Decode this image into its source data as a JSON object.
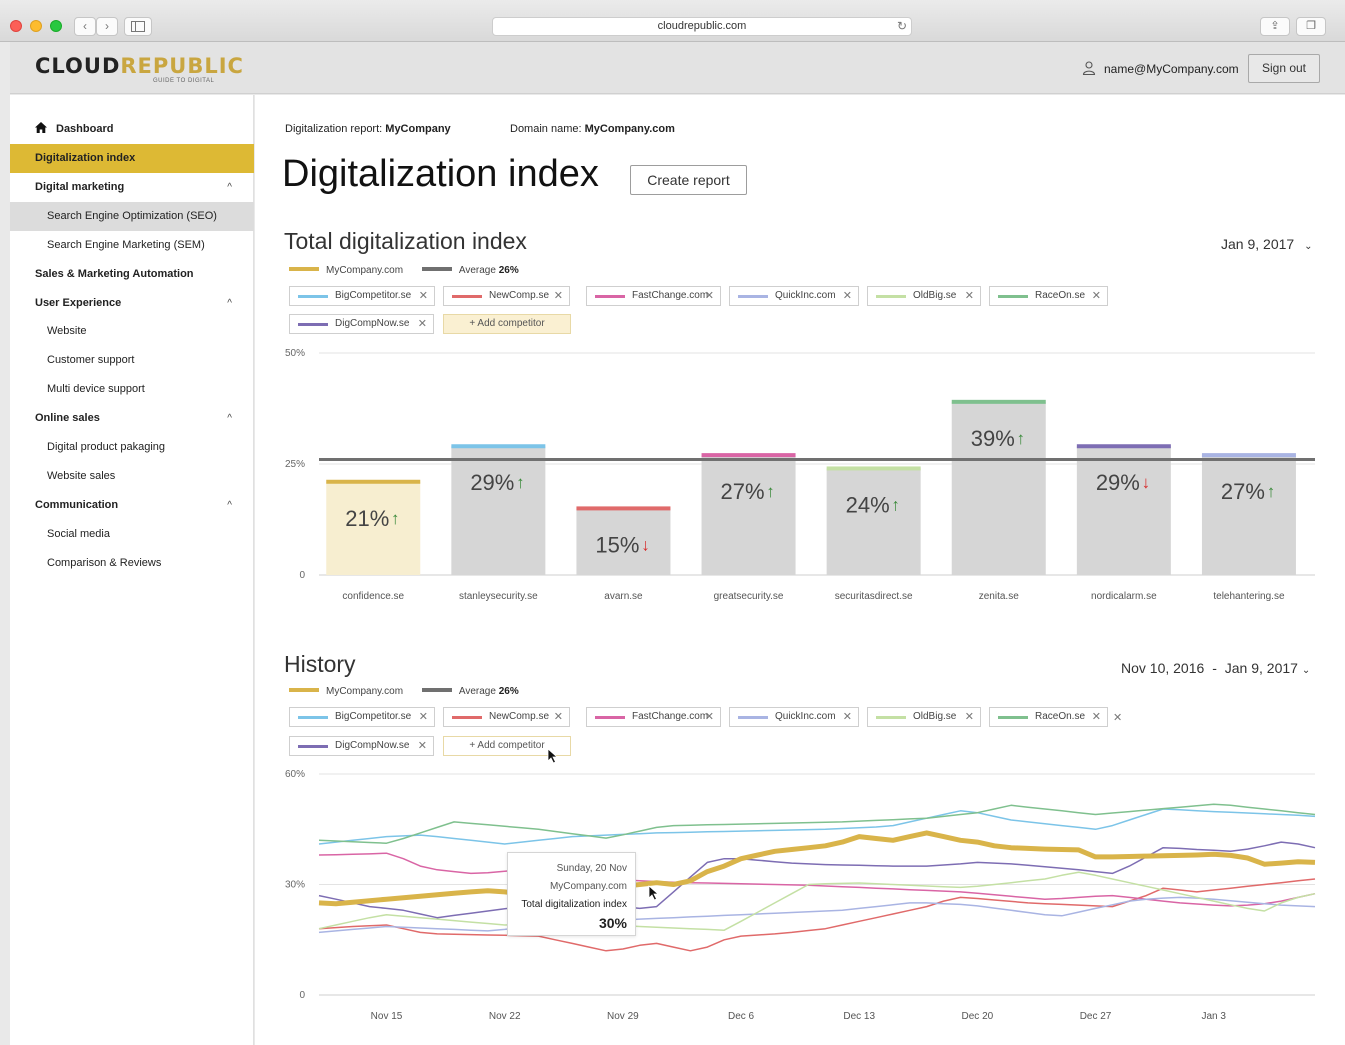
{
  "browser": {
    "url": "cloudrepublic.com"
  },
  "header": {
    "logo_primary": "CLOUD",
    "logo_accent": "REPUBLIC",
    "logo_tagline": "GUIDE TO DIGITAL",
    "user_email": "name@MyCompany.com",
    "signout_label": "Sign out"
  },
  "sidebar": {
    "dashboard": "Dashboard",
    "items": [
      {
        "label": "Digitalization index",
        "level": 1,
        "state": "active"
      },
      {
        "label": "Digital marketing",
        "level": 1,
        "chevron": "^"
      },
      {
        "label": "Search Engine Optimization (SEO)",
        "level": 2,
        "state": "selected"
      },
      {
        "label": "Search Engine Marketing (SEM)",
        "level": 2
      },
      {
        "label": "Sales & Marketing Automation",
        "level": 1
      },
      {
        "label": "User Experience",
        "level": 1,
        "chevron": "^"
      },
      {
        "label": "Website",
        "level": 2
      },
      {
        "label": "Customer support",
        "level": 2
      },
      {
        "label": "Multi device support",
        "level": 2
      },
      {
        "label": "Online sales",
        "level": 1,
        "chevron": "^"
      },
      {
        "label": "Digital product pakaging",
        "level": 2
      },
      {
        "label": "Website sales",
        "level": 2
      },
      {
        "label": "Communication",
        "level": 1,
        "chevron": "^"
      },
      {
        "label": "Social media",
        "level": 2
      },
      {
        "label": "Comparison & Reviews",
        "level": 2
      }
    ]
  },
  "main": {
    "report_label": "Digitalization report:",
    "report_value": "MyCompany",
    "domain_label": "Domain name:",
    "domain_value": "MyCompany.com",
    "title": "Digitalization index",
    "create_report": "Create report"
  },
  "total_section": {
    "title": "Total digitalization index",
    "date": "Jan 9, 2017",
    "legend_company": "MyCompany.com",
    "legend_average": "Average",
    "legend_average_value": "26%",
    "add_competitor": "+ Add competitor"
  },
  "history_section": {
    "title": "History",
    "date_from": "Nov 10, 2016",
    "date_sep": "-",
    "date_to": "Jan 9, 2017",
    "legend_company": "MyCompany.com",
    "legend_average": "Average",
    "legend_average_value": "26%",
    "add_competitor": "+ Add competitor"
  },
  "competitors": [
    {
      "name": "BigCompetitor.se",
      "color": "#7cc4e8"
    },
    {
      "name": "NewComp.se",
      "color": "#e06a6a"
    },
    {
      "name": "FastChange.com",
      "color": "#d965a5"
    },
    {
      "name": "QuickInc.com",
      "color": "#a9b4e3"
    },
    {
      "name": "OldBig.se",
      "color": "#c4e0a4"
    },
    {
      "name": "RaceOn.se",
      "color": "#7fc08e"
    },
    {
      "name": "DigCompNow.se",
      "color": "#7d6db3"
    }
  ],
  "colors": {
    "company": "#d9b44a",
    "average": "#707070",
    "bar_company_fill": "#f7eed0",
    "bar_fill": "#d6d6d6",
    "up_arrow": "#3a8a3a",
    "down_arrow": "#d62c2c",
    "sidebar_active": "#ddb934"
  },
  "tooltip": {
    "day": "Sunday, 20 Nov",
    "company": "MyCompany.com",
    "metric": "Total digitalization index",
    "value": "30%"
  },
  "chart_data": [
    {
      "type": "bar",
      "categories": [
        "confidence.se",
        "stanleysecurity.se",
        "avarn.se",
        "greatsecurity.se",
        "securitasdirect.se",
        "zenita.se",
        "nordicalarm.se",
        "telehantering.se"
      ],
      "values": [
        21,
        29,
        15,
        27,
        24,
        39,
        29,
        27
      ],
      "value_labels": [
        "21%",
        "29%",
        "15%",
        "27%",
        "24%",
        "39%",
        "29%",
        "27%"
      ],
      "trend": [
        "up",
        "up",
        "down",
        "up",
        "up",
        "up",
        "down",
        "up"
      ],
      "top_colors": [
        "#d9b44a",
        "#7cc4e8",
        "#e06a6a",
        "#d965a5",
        "#c4e0a4",
        "#7fc08e",
        "#7d6db3",
        "#a9b4e3"
      ],
      "average": 26,
      "ylim": [
        0,
        50
      ],
      "yticks": [
        "0",
        "25%",
        "50%"
      ],
      "grid": true
    },
    {
      "type": "line",
      "x": [
        "Nov 11",
        "Nov 12",
        "Nov 13",
        "Nov 14",
        "Nov 15",
        "Nov 16",
        "Nov 17",
        "Nov 18",
        "Nov 19",
        "Nov 20",
        "Nov 21",
        "Nov 22",
        "Nov 23",
        "Nov 24",
        "Nov 25",
        "Nov 26",
        "Nov 27",
        "Nov 28",
        "Nov 29",
        "Nov 30",
        "Dec 1",
        "Dec 2",
        "Dec 3",
        "Dec 4",
        "Dec 5",
        "Dec 6",
        "Dec 7",
        "Dec 8",
        "Dec 9",
        "Dec 10",
        "Dec 11",
        "Dec 12",
        "Dec 13",
        "Dec 14",
        "Dec 15",
        "Dec 16",
        "Dec 17",
        "Dec 18",
        "Dec 19",
        "Dec 20",
        "Dec 21",
        "Dec 22",
        "Dec 23",
        "Dec 24",
        "Dec 25",
        "Dec 26",
        "Dec 27",
        "Dec 28",
        "Dec 29",
        "Dec 30",
        "Dec 31",
        "Jan 1",
        "Jan 2",
        "Jan 3",
        "Jan 4",
        "Jan 5",
        "Jan 6",
        "Jan 7",
        "Jan 8",
        "Jan 9"
      ],
      "xticks": [
        "Nov 15",
        "Nov 22",
        "Nov 29",
        "Dec 6",
        "Dec 13",
        "Dec 20",
        "Dec 27",
        "Jan 3"
      ],
      "ylim": [
        0,
        60
      ],
      "yticks": [
        "0",
        "30%",
        "60%"
      ],
      "grid": true,
      "series": [
        {
          "name": "BigCompetitor.se",
          "color": "#7cc4e8",
          "width": 1.5,
          "values": [
            41,
            41.5,
            42,
            42.5,
            43,
            43.2,
            43.4,
            43,
            42.5,
            42,
            41.5,
            41,
            41.5,
            42,
            42.5,
            43,
            43.2,
            43.4,
            43.6,
            43.8,
            44,
            44.1,
            44.2,
            44.3,
            44.4,
            44.5,
            44.6,
            44.7,
            44.8,
            44.9,
            45,
            45.2,
            45.4,
            45.6,
            46,
            47,
            48,
            49,
            50,
            49.5,
            48.5,
            47.5,
            47,
            46.5,
            46,
            45.5,
            45,
            46,
            47.5,
            49,
            50.5,
            50.3,
            50,
            49.8,
            49.6,
            49.4,
            49.2,
            49,
            48.8,
            48.5
          ]
        },
        {
          "name": "NewComp.se",
          "color": "#e06a6a",
          "width": 1.5,
          "values": [
            18,
            18.3,
            18.6,
            18.8,
            19,
            18,
            17,
            16.6,
            16.5,
            16.4,
            16.3,
            16.2,
            16.1,
            16,
            15,
            14,
            13,
            12,
            12.5,
            13.5,
            14,
            13,
            12,
            13,
            15,
            16,
            16.3,
            16.6,
            17,
            17.5,
            18,
            19,
            20,
            21,
            22,
            23,
            24,
            25.5,
            26.5,
            26.2,
            25.8,
            25.4,
            25,
            24.8,
            24.6,
            24.4,
            24.2,
            24,
            25.5,
            27,
            29,
            28.5,
            28,
            28.5,
            29,
            29.5,
            30,
            30.5,
            31,
            31.5
          ]
        },
        {
          "name": "FastChange.com",
          "color": "#d965a5",
          "width": 1.5,
          "values": [
            38,
            38.1,
            38.2,
            38.3,
            38.5,
            37,
            35,
            34,
            33.5,
            33,
            33.2,
            33.6,
            34,
            33.5,
            33,
            32.5,
            32,
            31.6,
            31.3,
            31,
            30.8,
            30.6,
            30.5,
            30.4,
            30.3,
            30.2,
            30.1,
            30,
            29.9,
            29.8,
            29.6,
            29.4,
            29.2,
            29,
            28.8,
            28.6,
            28.4,
            28.2,
            28,
            27.6,
            27.2,
            26.8,
            26.4,
            26,
            26.2,
            26.5,
            26.8,
            27,
            26.5,
            26,
            25.5,
            25,
            24.7,
            24.4,
            24.2,
            24.4,
            24.8,
            25.5,
            26.5,
            27.5
          ]
        },
        {
          "name": "QuickInc.com",
          "color": "#a9b4e3",
          "width": 1.5,
          "values": [
            17,
            17.4,
            17.8,
            18.2,
            18.6,
            18.4,
            18.2,
            18,
            17.8,
            17.6,
            17.4,
            17.8,
            18.4,
            19,
            19.5,
            19.8,
            20,
            20.2,
            20.4,
            20.6,
            20.8,
            21,
            21.2,
            21.4,
            21.6,
            21.8,
            22,
            22.2,
            22.4,
            22.6,
            22.8,
            23,
            23.5,
            24,
            24.5,
            25,
            25,
            24.8,
            24.6,
            24.2,
            23.6,
            23,
            22.4,
            21.8,
            21.5,
            22.5,
            23.5,
            24.5,
            25.5,
            26,
            26.3,
            26.5,
            26.3,
            26,
            25.6,
            25.2,
            24.8,
            24.4,
            24.2,
            24
          ]
        },
        {
          "name": "OldBig.se",
          "color": "#c4e0a4",
          "width": 1.5,
          "values": [
            18,
            19,
            20,
            21,
            21.8,
            21.4,
            21,
            20.6,
            20.2,
            19.8,
            19.4,
            19,
            19.2,
            19.4,
            19.6,
            19.4,
            19.2,
            19,
            18.8,
            18.6,
            18.4,
            18.2,
            18,
            17.8,
            17.6,
            20,
            22.5,
            25,
            27.5,
            30,
            30.2,
            30.3,
            30.4,
            30.2,
            30,
            29.8,
            29.6,
            29.4,
            29.2,
            29.5,
            30,
            30.5,
            31,
            31.5,
            32.5,
            33.3,
            32.5,
            31.5,
            30.5,
            29.5,
            28.5,
            27.5,
            26.5,
            25.5,
            24.5,
            23.5,
            22.8,
            25,
            26.5,
            27.5
          ]
        },
        {
          "name": "RaceOn.se",
          "color": "#7fc08e",
          "width": 1.5,
          "values": [
            42,
            41.8,
            41.6,
            41.4,
            41.2,
            42.5,
            44,
            45.5,
            47,
            46.6,
            46.2,
            45.8,
            45.4,
            45,
            44.4,
            43.8,
            43.2,
            42.6,
            43.5,
            44.5,
            45.5,
            46,
            46.1,
            46.2,
            46.3,
            46.4,
            46.5,
            46.6,
            46.7,
            46.8,
            46.9,
            47,
            47.2,
            47.4,
            47.6,
            47.8,
            48,
            48.5,
            49,
            49.5,
            50.5,
            51.5,
            51,
            50.5,
            50,
            49.5,
            49,
            49.4,
            49.8,
            50.2,
            50.6,
            51,
            51.4,
            51.8,
            51.5,
            51,
            50.5,
            50,
            49.5,
            49
          ]
        },
        {
          "name": "DigCompNow.se",
          "color": "#7d6db3",
          "width": 1.5,
          "values": [
            27,
            26,
            25,
            24,
            23.5,
            23,
            22,
            21,
            21.6,
            22.2,
            22.8,
            23.4,
            24,
            24.3,
            24.6,
            24.9,
            25.2,
            25.5,
            24,
            23.5,
            24,
            28,
            32,
            36,
            37,
            37,
            36.6,
            36.2,
            35.8,
            35.6,
            35.4,
            35.3,
            35.2,
            35.1,
            35,
            35,
            35,
            35.3,
            35.6,
            36,
            35.8,
            35.6,
            35.2,
            34.8,
            34.4,
            34,
            33.5,
            33,
            35,
            37.5,
            40,
            39.8,
            39.5,
            39.3,
            39,
            39.6,
            40.5,
            41.5,
            41,
            40
          ]
        },
        {
          "name": "MyCompany.com",
          "color": "#d9b44a",
          "width": 5,
          "values": [
            25,
            24.8,
            25.2,
            25.6,
            26,
            26.4,
            26.8,
            27.2,
            27.6,
            28,
            28.3,
            28,
            27.5,
            27.4,
            27.6,
            28,
            28.2,
            28.8,
            29.5,
            30,
            30.5,
            30,
            31,
            33.5,
            35,
            37,
            38,
            39,
            39.5,
            40,
            40.5,
            41.5,
            43,
            42.5,
            42,
            43,
            44,
            43,
            42,
            41.5,
            40.5,
            40,
            39.8,
            39.6,
            39.5,
            39.4,
            37.5,
            37.5,
            37.6,
            37.7,
            37.8,
            37.9,
            38,
            38.2,
            37.9,
            37.2,
            35.5,
            35.8,
            36.2,
            36
          ]
        }
      ]
    }
  ]
}
